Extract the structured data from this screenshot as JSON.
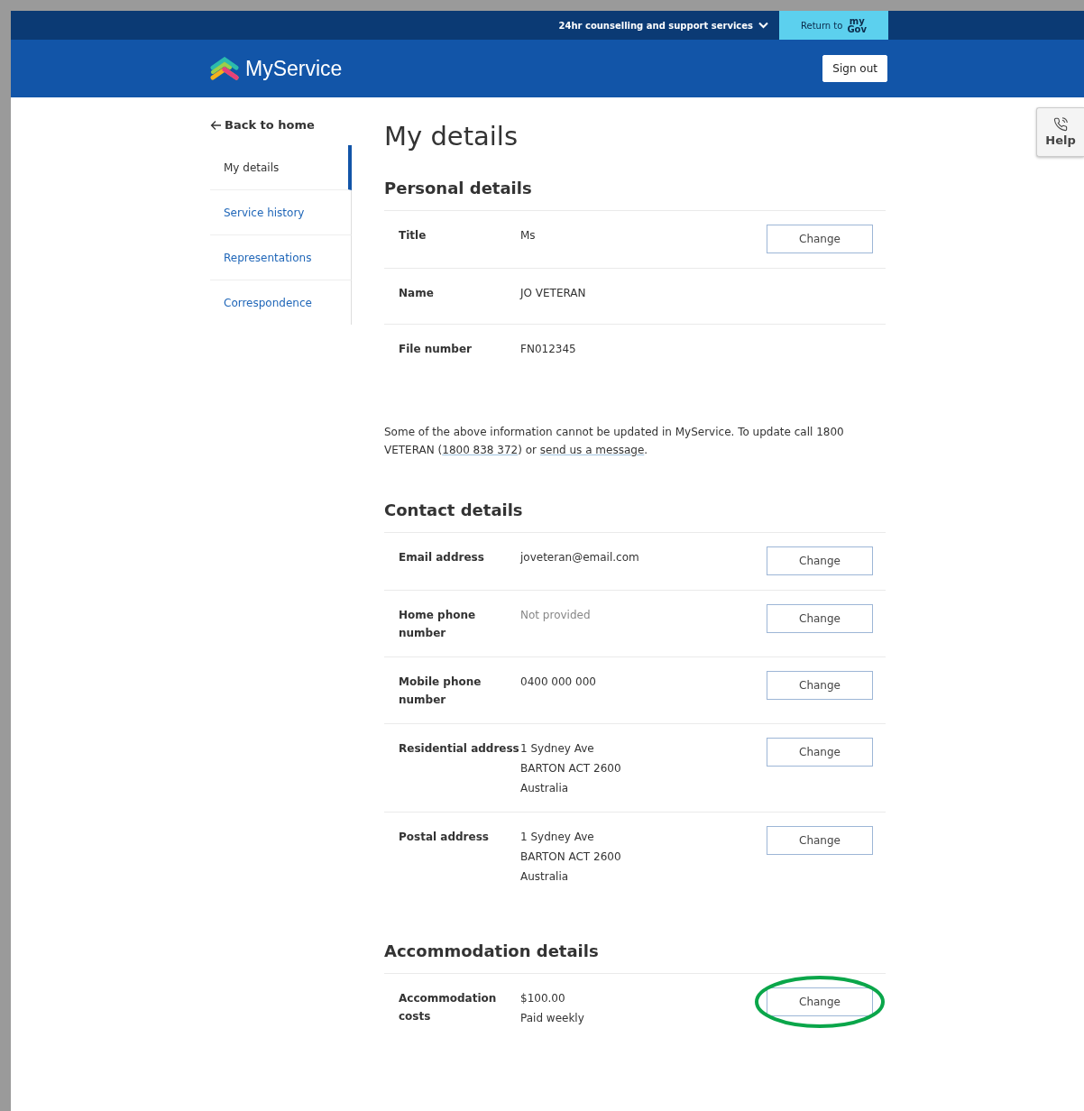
{
  "top_bar": {
    "support_link": "24hr counselling and support services",
    "return_button": {
      "prefix": "Return to",
      "brand_top": "my",
      "brand_bottom": "Gov"
    }
  },
  "header": {
    "logo": "MyService",
    "sign_out": "Sign out"
  },
  "help_tab": {
    "label": "Help"
  },
  "sidebar": {
    "back_link": "Back to home",
    "items": [
      {
        "label": "My details",
        "selected": true
      },
      {
        "label": "Service history",
        "selected": false
      },
      {
        "label": "Representations",
        "selected": false
      },
      {
        "label": "Correspondence",
        "selected": false
      }
    ]
  },
  "page_title": "My details",
  "sections": [
    {
      "heading": "Personal details",
      "rows": [
        {
          "label": "Title",
          "values": [
            "Ms"
          ],
          "muted": false,
          "button": "Change",
          "highlighted": false
        },
        {
          "label": "Name",
          "values": [
            "JO VETERAN"
          ],
          "muted": false
        },
        {
          "label": "File number",
          "values": [
            "FN012345"
          ],
          "muted": false
        }
      ],
      "note": [
        {
          "text": "Some of the above information cannot be updated in MyService. To update call 1800 VETERAN (",
          "link": false
        },
        {
          "text": "1800 838 372",
          "link": true
        },
        {
          "text": ") or ",
          "link": false
        },
        {
          "text": "send us a message",
          "link": true
        },
        {
          "text": ".",
          "link": false
        }
      ]
    },
    {
      "heading": "Contact details",
      "rows": [
        {
          "label": "Email address",
          "values": [
            "joveteran@email.com"
          ],
          "muted": false,
          "button": "Change",
          "highlighted": false
        },
        {
          "label": "Home phone number",
          "values": [
            "Not provided"
          ],
          "muted": true,
          "button": "Change",
          "highlighted": false
        },
        {
          "label": "Mobile phone number",
          "values": [
            "0400 000 000"
          ],
          "muted": false,
          "button": "Change",
          "highlighted": false
        },
        {
          "label": "Residential address",
          "values": [
            "1 Sydney Ave",
            "BARTON ACT 2600",
            "Australia"
          ],
          "muted": false,
          "button": "Change",
          "highlighted": false
        },
        {
          "label": "Postal address",
          "values": [
            "1 Sydney Ave",
            "BARTON ACT 2600",
            "Australia"
          ],
          "muted": false,
          "button": "Change",
          "highlighted": false
        }
      ]
    },
    {
      "heading": "Accommodation details",
      "rows": [
        {
          "label": "Accommodation costs",
          "values": [
            "$100.00",
            "Paid weekly"
          ],
          "muted": false,
          "button": "Change",
          "highlighted": true
        }
      ]
    }
  ]
}
